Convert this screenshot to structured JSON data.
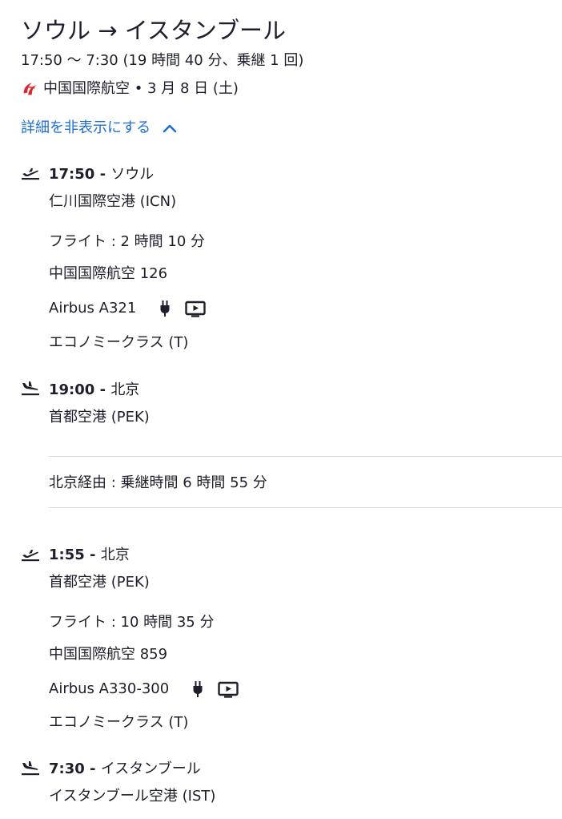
{
  "header": {
    "title": "ソウル → イスタンブール",
    "times_summary": "17:50 〜 7:30 (19 時間 40 分、乗継 1 回)",
    "airline_summary": "中国国際航空 • 3 月 8 日 (土)",
    "toggle_label": "詳細を非表示にする"
  },
  "legs": [
    {
      "departure": {
        "time": "17:50",
        "sep": " - ",
        "city": "ソウル",
        "airport": "仁川国際空港 (ICN)"
      },
      "duration": "フライト : 2 時間 10 分",
      "flight": "中国国際航空 126",
      "aircraft": "Airbus A321",
      "cabin": "エコノミークラス (T)",
      "arrival": {
        "time": "19:00",
        "sep": " - ",
        "city": "北京",
        "airport": "首都空港 (PEK)"
      }
    },
    {
      "departure": {
        "time": "1:55",
        "sep": " - ",
        "city": "北京",
        "airport": "首都空港 (PEK)"
      },
      "duration": "フライト : 10 時間 35 分",
      "flight": "中国国際航空 859",
      "aircraft": "Airbus A330-300",
      "cabin": "エコノミークラス (T)",
      "arrival": {
        "time": "7:30",
        "sep": " - ",
        "city": "イスタンブール",
        "airport": "イスタンブール空港 (IST)"
      }
    }
  ],
  "layover": {
    "text": "北京経由 : 乗継時間 6 時間 55 分"
  },
  "icons": {
    "airline_logo": "air-china-logo",
    "departure": "plane-takeoff-icon",
    "arrival": "plane-landing-icon",
    "power": "power-plug-icon",
    "entertainment": "video-screen-icon",
    "chevron": "chevron-up-icon"
  },
  "colors": {
    "text": "#1e1e2c",
    "link": "#1f6fd1",
    "divider": "#dcdce0",
    "logo_red": "#d9272e"
  }
}
